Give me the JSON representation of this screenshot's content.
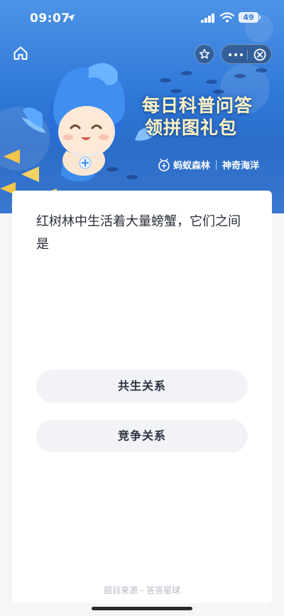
{
  "status_bar": {
    "time": "09:07",
    "battery": "49"
  },
  "banner": {
    "title_line1": "每日科普问答",
    "title_line2": "领拼图礼包",
    "brand1": "蚂蚁森林",
    "brand2": "神奇海洋"
  },
  "quiz": {
    "question": "红树林中生活着大量螃蟹，它们之间是",
    "options": [
      "共生关系",
      "竞争关系"
    ],
    "source": "题目来源 - 答答星球"
  }
}
